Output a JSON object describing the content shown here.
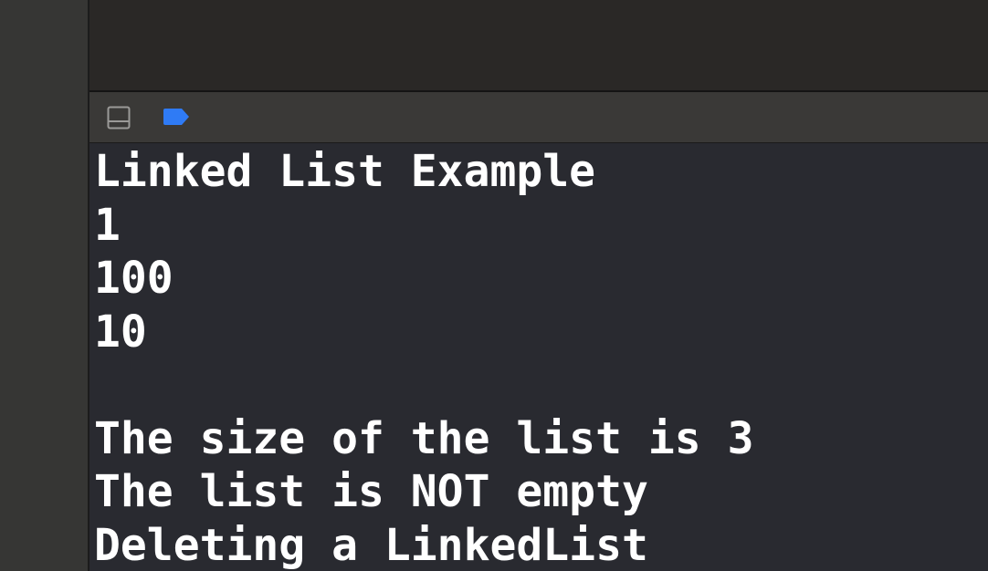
{
  "console": {
    "toolbar": {
      "panel_toggle_icon": "panel-bottom-icon",
      "breakpoint_icon": "breakpoint-icon",
      "breakpoint_color": "#2f7bf5"
    },
    "output_lines": [
      "Linked List Example",
      "1",
      "100",
      "10",
      "",
      "The size of the list is 3",
      "The list is NOT empty",
      "Deleting a LinkedList"
    ]
  }
}
